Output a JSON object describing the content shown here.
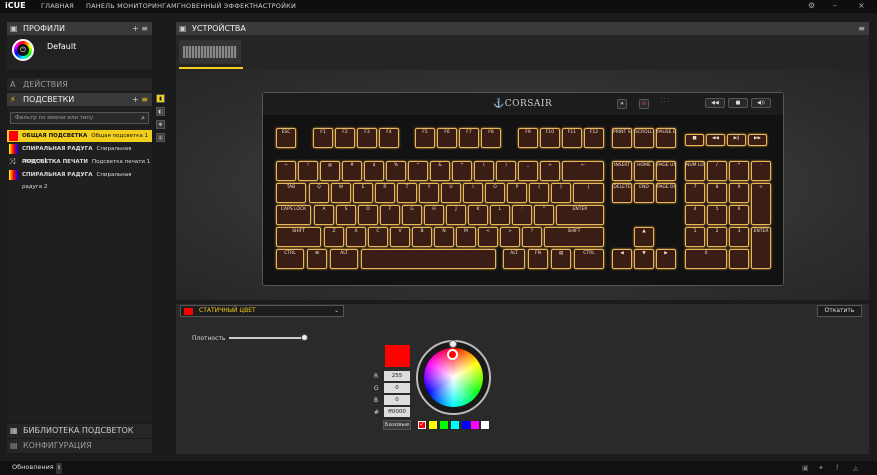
{
  "app": {
    "brand": "iCUE"
  },
  "topnav": [
    "ГЛАВНАЯ",
    "ПАНЕЛЬ МОНИТОРИНГА",
    "МГНОВЕННЫЙ ЭФФЕКТ",
    "НАСТРОЙКИ"
  ],
  "window": {
    "settings_icon": "⚙",
    "minimize": "–",
    "close": "×"
  },
  "profiles": {
    "title": "ПРОФИЛИ",
    "add": "+",
    "menu": "≡",
    "item": "Default"
  },
  "actions": {
    "title": "ДЕЙСТВИЯ",
    "icon": "A"
  },
  "lighting": {
    "title": "ПОДСВЕТКИ",
    "add": "+",
    "menu": "≡",
    "filter_placeholder": "Фильтр по имени или типу",
    "items": [
      {
        "name": "ОБЩАЯ ПОДСВЕТКА",
        "desc": "Общая подсветка 1",
        "color": "#ff0000"
      },
      {
        "name": "СПИРАЛЬНАЯ РАДУГА",
        "desc": "Спиральная радуга 1",
        "color": "#7b2bd6"
      },
      {
        "name": "ПОДСВЕТКА ПЕЧАТИ",
        "desc": "Подсветка печати 1",
        "color": ""
      },
      {
        "name": "СПИРАЛЬНАЯ РАДУГА",
        "desc": "Спиральная радуга 2",
        "color": "#7b2bd6"
      }
    ]
  },
  "devices": {
    "title": "УСТРОЙСТВА",
    "menu": "≡"
  },
  "keyboard": {
    "brand": "CORSAIR",
    "rows": {
      "fn": [
        "ESC",
        "F1",
        "F2",
        "F3",
        "F4",
        "F5",
        "F6",
        "F7",
        "F8",
        "F9",
        "F10",
        "F11",
        "F12"
      ],
      "num": [
        "~",
        "!",
        "@",
        "#",
        "$",
        "%",
        "^",
        "&",
        "*",
        "(",
        ")",
        "_",
        "+",
        "←"
      ],
      "tab": [
        "TAB",
        "Q",
        "W",
        "E",
        "R",
        "T",
        "Y",
        "U",
        "I",
        "O",
        "P",
        "{",
        "}",
        "|"
      ],
      "caps": [
        "CAPS LOCK",
        "A",
        "S",
        "D",
        "F",
        "G",
        "H",
        "J",
        "K",
        "L",
        ":",
        "\"",
        "ENTER"
      ],
      "shift": [
        "SHIFT",
        "Z",
        "X",
        "C",
        "V",
        "B",
        "N",
        "M",
        "<",
        ">",
        "?",
        "SHIFT"
      ],
      "ctrl": [
        "CTRL",
        "⊞",
        "ALT",
        "",
        "ALT",
        "FN",
        "▤",
        "CTRL"
      ]
    },
    "nav": [
      "PRINT SCREEN",
      "SCROLL LOCK",
      "PAUSE BREAK",
      "INSERT",
      "HOME",
      "PAGE UP",
      "DELETE",
      "END",
      "PAGE DOWN"
    ],
    "arrows": [
      "▲",
      "◀",
      "▼",
      "▶"
    ],
    "numpad": [
      "NUM LOCK",
      "/",
      "*",
      "-",
      "7",
      "8",
      "9",
      "+",
      "4",
      "5",
      "6",
      "1",
      "2",
      "3",
      "ENTER",
      "0",
      "."
    ]
  },
  "effect": {
    "name": "СТАТИЧНЫЙ ЦВЕТ",
    "chevron": "⌄",
    "undo": "Откатить",
    "swatch_color": "#ff0000"
  },
  "color": {
    "density_label": "Плотность",
    "r_label": "R",
    "r": "255",
    "g_label": "G",
    "g": "0",
    "b_label": "B",
    "b": "0",
    "hex_label": "#",
    "hex": "ff0000",
    "base_label": "Базовые",
    "swatches": [
      "#ff0000",
      "#ffff00",
      "#00ff00",
      "#00ffff",
      "#0000ff",
      "#ff00ff",
      "#ffffff",
      "#ffd700"
    ]
  },
  "library": {
    "title": "БИБЛИОТЕКА ПОДСВЕТОК"
  },
  "config": {
    "title": "КОНФИГУРАЦИЯ"
  },
  "status": {
    "updates": "Обновления"
  }
}
